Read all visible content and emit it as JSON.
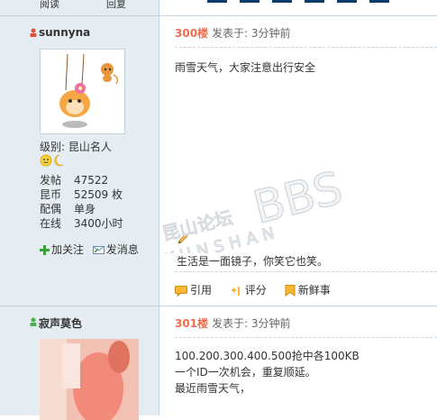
{
  "top": {
    "read_label": "阅读",
    "reply_label": "回复"
  },
  "posts": [
    {
      "username": "sunnyna",
      "rank_label": "级别:",
      "rank_name": "昆山名人",
      "stats": [
        {
          "label": "发帖",
          "value": "47522"
        },
        {
          "label": "昆币",
          "value": "52509 枚"
        },
        {
          "label": "配偶",
          "value": "单身"
        },
        {
          "label": "在线",
          "value": "3400小时"
        }
      ],
      "actions": {
        "follow": "加关注",
        "message": "发消息"
      },
      "floor": "300楼",
      "posted": "发表于: 3分钟前",
      "body_lines": [
        "雨雪天气，大家注意出行安全"
      ],
      "signature": "生活是一面镜子，你笑它也笑。",
      "toolbar": {
        "quote": "引用",
        "rate": "评分",
        "fresh": "新鲜事"
      }
    },
    {
      "username": "寂声莫色",
      "floor": "301楼",
      "posted": "发表于: 3分钟前",
      "body_lines": [
        "100.200.300.400.500抢中各100KB",
        "一个ID一次机会，重复顺延。",
        "最近雨雪天气，"
      ]
    }
  ],
  "watermark": {
    "cn": "昆山论坛",
    "en1": "KUNSHAN",
    "en2": "BBS"
  },
  "colors": {
    "sidebar_bg": "#e5edf2",
    "border": "#c2d5e3",
    "floor_orange": "#f26c4f",
    "text": "#333333"
  }
}
